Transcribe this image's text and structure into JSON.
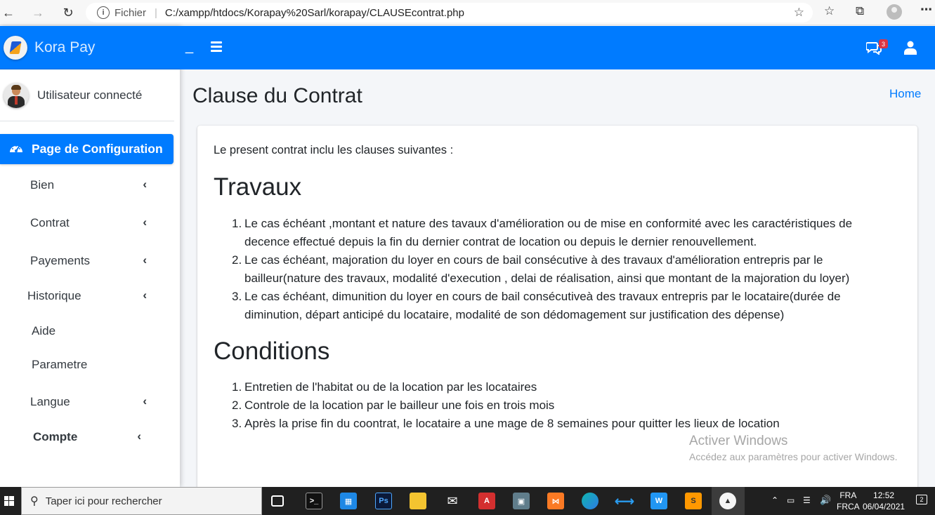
{
  "browser": {
    "site_info_label": "Fichier",
    "url": "C:/xampp/htdocs/Korapay%20Sarl/korapay/CLAUSEcontrat.php"
  },
  "brand": {
    "name": "Kora Pay"
  },
  "user": {
    "name": "Utilisateur connecté"
  },
  "sidebar": {
    "active_item": "Page de Configuration",
    "items": [
      {
        "label": "Bien",
        "has_chevron": true
      },
      {
        "label": "Contrat",
        "has_chevron": true
      },
      {
        "label": "Payements",
        "has_chevron": true
      },
      {
        "label": "Historique",
        "has_chevron": true
      },
      {
        "label": "Aide",
        "has_chevron": false
      },
      {
        "label": "Parametre",
        "has_chevron": false
      },
      {
        "label": "Langue",
        "has_chevron": true
      },
      {
        "label": "Compte",
        "has_chevron": true
      }
    ]
  },
  "topnav": {
    "dash": "_",
    "notification_count": "3"
  },
  "page": {
    "title": "Clause du Contrat",
    "breadcrumb_home": "Home",
    "intro": "Le present contrat inclu les clauses suivantes :",
    "section1_title": "Travaux",
    "section1_items": [
      "Le cas échéant ,montant et nature des tavaux d'amélioration ou de mise en conformité avec les caractéristiques de decence effectué depuis la fin du dernier contrat de location ou depuis le dernier renouvellement.",
      "Le cas échéant, majoration du loyer en cours de bail consécutive à des travaux d'amélioration entrepris par le bailleur(nature des travaux, modalité d'execution , delai de réalisation, ainsi que montant de la majoration du loyer)",
      "Le cas échéant, dimunition du loyer en cours de bail consécutiveà des travaux entrepris par le locataire(durée de diminution, départ anticipé du locataire, modalité de son dédomagement sur justification des dépense)"
    ],
    "section2_title": "Conditions",
    "section2_items": [
      "Entretien de l'habitat ou de la location par les locataires",
      "Controle de la location par le bailleur une fois en trois mois",
      "Après la prise fin du coontrat, le locataire a une mage de 8 semaines pour quitter les lieux de location"
    ]
  },
  "watermark": {
    "line1": "Activer Windows",
    "line2": "Accédez aux paramètres pour activer Windows."
  },
  "taskbar": {
    "search_placeholder": "Taper ici pour rechercher",
    "lang_line1": "FRA",
    "lang_line2": "FRCA",
    "time": "12:52",
    "date": "06/04/2021",
    "notification_count": "2"
  },
  "colors": {
    "primary": "#007bff",
    "badge": "#dc3545",
    "taskbar": "#202020"
  }
}
